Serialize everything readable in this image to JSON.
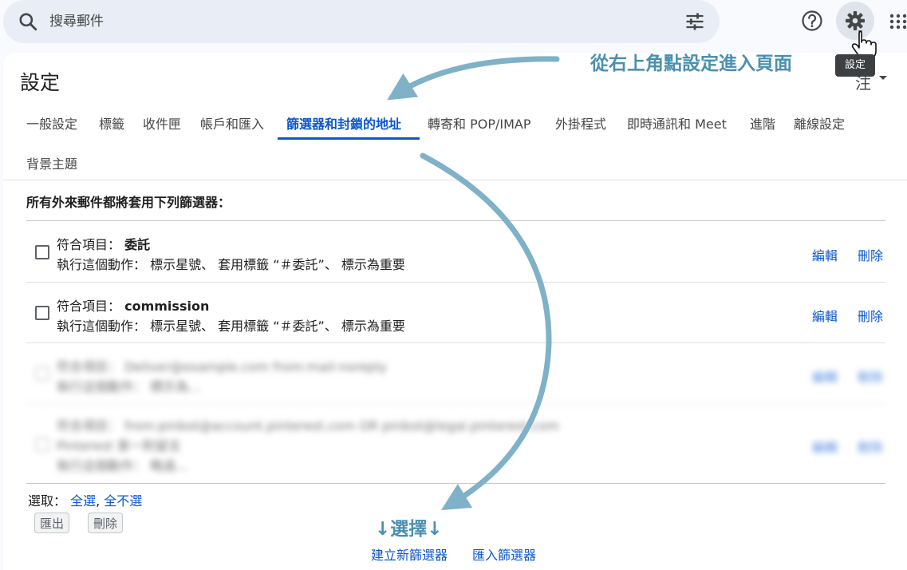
{
  "search": {
    "placeholder": "搜尋郵件"
  },
  "header": {
    "tooltip": "設定",
    "lang_partial": "注"
  },
  "page": {
    "title": "設定"
  },
  "tabs": [
    "一般設定",
    "標籤",
    "收件匣",
    "帳戶和匯入",
    "篩選器和封鎖的地址",
    "轉寄和 POP/IMAP",
    "外掛程式",
    "即時通訊和 Meet",
    "進階",
    "離線設定",
    "背景主題"
  ],
  "active_tab": "篩選器和封鎖的地址",
  "section": {
    "heading": "所有外來郵件都將套用下列篩選器："
  },
  "filters": [
    {
      "match_label": "符合項目：",
      "match_value": "委託",
      "action_text": "執行這個動作： 標示星號、 套用標籤 “＃委託”、 標示為重要",
      "edit": "編輯",
      "delete": "刪除"
    },
    {
      "match_label": "符合項目：",
      "match_value": "commission",
      "action_text": "執行這個動作： 標示星號、 套用標籤 “＃委託”、 標示為重要",
      "edit": "編輯",
      "delete": "刪除"
    }
  ],
  "blurred_filters": [
    {
      "line1": "符合項目： Deliver@example.com from:mail-noreply",
      "line2": "執行這個動作： 標示為…",
      "edit": "編輯",
      "delete": "刪除"
    },
    {
      "line1": "符合項目： from:pinbot@account.pinterest.com OR pinbot@legal.pinterest.com",
      "line2": "Pinterest 第一則留言",
      "line3": "執行這個動作： 略過…",
      "edit": "編輯",
      "delete": "刪除"
    }
  ],
  "select_row": {
    "label": "選取：",
    "all": "全選",
    "none": "全不選"
  },
  "buttons": {
    "export": "匯出",
    "delete": "刪除"
  },
  "bottom_links": {
    "create": "建立新篩選器",
    "import": "匯入篩選器"
  },
  "annotations": {
    "top": "從右上角點設定進入頁面",
    "select": "↓選擇↓"
  },
  "colors": {
    "accent": "#0b57d0",
    "annotation": "#4a90b0",
    "search_bg": "#e9eef6"
  }
}
